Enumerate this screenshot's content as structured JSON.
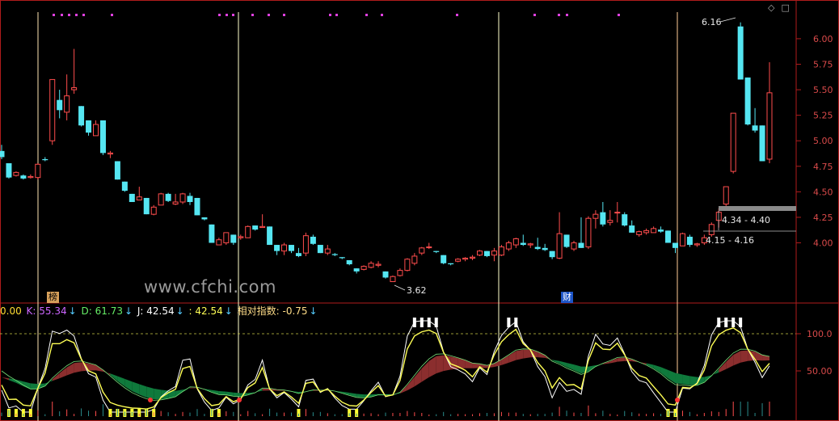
{
  "price_axis": {
    "ticks": [
      "6.00",
      "5.75",
      "5.50",
      "5.25",
      "5.00",
      "4.75",
      "4.50",
      "4.25",
      "4.00"
    ],
    "min": 3.45,
    "max": 6.3
  },
  "indicator_axis": {
    "ticks": [
      "100.0",
      "50.00"
    ]
  },
  "annotations": {
    "high_label": "6.16",
    "low_label": "3.62",
    "range_upper": "4.34 - 4.40",
    "range_lower": "4.15 - 4.16"
  },
  "tags": {
    "bang": "榜",
    "cai": "财"
  },
  "watermark": "www.cfchi.com",
  "indicator": {
    "prefix": "0.00",
    "k_label": "K: 55.34",
    "d_label": "D: 61.73",
    "j_label": "J: 42.54",
    "x_label": ": 42.54",
    "rel_label": "相对指数: -0.75",
    "arrow": "↓"
  },
  "icons": [
    "diamond-icon",
    "maximize-icon"
  ],
  "colors": {
    "up": "#ff4d4d",
    "down": "#55e6f2",
    "k_line": "#ffffff",
    "d_line": "#ffff55",
    "band_green": "#0f7a3c",
    "band_red": "#8b2e2e",
    "axis": "#b01c1c",
    "vline": "#ffffcc",
    "magenta": "#e040e0",
    "ref_line": "#cccc44"
  },
  "chart_data": {
    "type": "candlestick",
    "ohlc": [
      [
        4.9,
        4.96,
        4.82,
        4.84
      ],
      [
        4.78,
        4.78,
        4.63,
        4.64
      ],
      [
        4.66,
        4.7,
        4.65,
        4.69
      ],
      [
        4.66,
        4.67,
        4.62,
        4.63
      ],
      [
        4.64,
        4.67,
        4.63,
        4.65
      ],
      [
        4.64,
        4.78,
        4.62,
        4.77
      ],
      [
        4.82,
        4.84,
        4.8,
        4.81
      ],
      [
        5.0,
        5.6,
        4.96,
        5.6
      ],
      [
        5.4,
        5.5,
        5.22,
        5.3
      ],
      [
        5.28,
        5.65,
        5.2,
        5.44
      ],
      [
        5.5,
        5.9,
        5.46,
        5.52
      ],
      [
        5.34,
        5.34,
        5.14,
        5.15
      ],
      [
        5.2,
        5.2,
        5.05,
        5.08
      ],
      [
        5.05,
        5.2,
        5.05,
        5.16
      ],
      [
        5.2,
        5.2,
        4.86,
        4.88
      ],
      [
        4.87,
        4.9,
        4.83,
        4.88
      ],
      [
        4.8,
        4.8,
        4.62,
        4.62
      ],
      [
        4.6,
        4.6,
        4.5,
        4.51
      ],
      [
        4.48,
        4.48,
        4.4,
        4.4
      ],
      [
        4.42,
        4.55,
        4.42,
        4.45
      ],
      [
        4.44,
        4.44,
        4.28,
        4.28
      ],
      [
        4.28,
        4.37,
        4.27,
        4.35
      ],
      [
        4.37,
        4.49,
        4.37,
        4.48
      ],
      [
        4.48,
        4.49,
        4.4,
        4.41
      ],
      [
        4.38,
        4.48,
        4.37,
        4.4
      ],
      [
        4.4,
        4.49,
        4.38,
        4.48
      ],
      [
        4.46,
        4.49,
        4.37,
        4.4
      ],
      [
        4.44,
        4.44,
        4.27,
        4.27
      ],
      [
        4.25,
        4.25,
        4.22,
        4.23
      ],
      [
        4.18,
        4.18,
        4.0,
        4.0
      ],
      [
        3.98,
        4.05,
        3.98,
        4.03
      ],
      [
        4.0,
        4.1,
        3.98,
        4.1
      ],
      [
        4.08,
        4.08,
        3.98,
        4.0
      ],
      [
        4.05,
        4.08,
        4.03,
        4.06
      ],
      [
        4.05,
        4.17,
        4.05,
        4.16
      ],
      [
        4.17,
        4.17,
        4.12,
        4.13
      ],
      [
        4.15,
        4.28,
        4.15,
        4.16
      ],
      [
        4.16,
        4.16,
        3.98,
        3.98
      ],
      [
        3.98,
        3.98,
        3.88,
        3.92
      ],
      [
        3.92,
        4.0,
        3.88,
        3.98
      ],
      [
        3.98,
        3.98,
        3.9,
        3.92
      ],
      [
        3.9,
        3.95,
        3.86,
        3.87
      ],
      [
        3.9,
        4.1,
        3.87,
        4.07
      ],
      [
        4.06,
        4.08,
        3.98,
        3.99
      ],
      [
        3.98,
        3.98,
        3.9,
        3.9
      ],
      [
        3.9,
        3.98,
        3.88,
        3.94
      ],
      [
        3.89,
        3.9,
        3.87,
        3.88
      ],
      [
        3.86,
        3.86,
        3.84,
        3.85
      ],
      [
        3.83,
        3.83,
        3.78,
        3.79
      ],
      [
        3.75,
        3.75,
        3.7,
        3.72
      ],
      [
        3.74,
        3.78,
        3.73,
        3.77
      ],
      [
        3.76,
        3.82,
        3.75,
        3.8
      ],
      [
        3.78,
        3.82,
        3.76,
        3.79
      ],
      [
        3.72,
        3.72,
        3.65,
        3.66
      ],
      [
        3.62,
        3.68,
        3.62,
        3.67
      ],
      [
        3.68,
        3.75,
        3.67,
        3.73
      ],
      [
        3.73,
        3.85,
        3.72,
        3.84
      ],
      [
        3.8,
        3.9,
        3.78,
        3.87
      ],
      [
        3.9,
        3.96,
        3.88,
        3.95
      ],
      [
        3.96,
        4.0,
        3.94,
        3.96
      ],
      [
        3.92,
        3.92,
        3.9,
        3.91
      ],
      [
        3.88,
        3.88,
        3.79,
        3.8
      ],
      [
        3.8,
        3.8,
        3.78,
        3.79
      ],
      [
        3.82,
        3.85,
        3.81,
        3.84
      ],
      [
        3.84,
        3.86,
        3.82,
        3.85
      ],
      [
        3.85,
        3.88,
        3.83,
        3.86
      ],
      [
        3.88,
        3.93,
        3.87,
        3.92
      ],
      [
        3.92,
        3.92,
        3.86,
        3.87
      ],
      [
        3.88,
        3.95,
        3.82,
        3.92
      ],
      [
        3.88,
        3.98,
        3.87,
        3.96
      ],
      [
        3.94,
        4.02,
        3.92,
        4.0
      ],
      [
        3.98,
        4.05,
        3.95,
        4.04
      ],
      [
        4.0,
        4.08,
        3.97,
        3.98
      ],
      [
        3.98,
        4.0,
        3.95,
        3.99
      ],
      [
        3.96,
        4.05,
        3.93,
        3.94
      ],
      [
        3.95,
        3.99,
        3.92,
        3.93
      ],
      [
        3.92,
        3.92,
        3.84,
        3.86
      ],
      [
        3.85,
        4.3,
        3.84,
        4.09
      ],
      [
        4.08,
        4.08,
        3.95,
        3.96
      ],
      [
        3.94,
        4.02,
        3.92,
        4.0
      ],
      [
        4.0,
        4.25,
        3.95,
        3.95
      ],
      [
        3.96,
        4.26,
        3.94,
        4.24
      ],
      [
        4.24,
        4.32,
        4.14,
        4.28
      ],
      [
        4.3,
        4.4,
        4.16,
        4.18
      ],
      [
        4.2,
        4.32,
        4.17,
        4.22
      ],
      [
        4.3,
        4.4,
        4.2,
        4.3
      ],
      [
        4.28,
        4.3,
        4.16,
        4.17
      ],
      [
        4.17,
        4.22,
        4.1,
        4.1
      ],
      [
        4.08,
        4.12,
        4.06,
        4.11
      ],
      [
        4.1,
        4.14,
        4.08,
        4.12
      ],
      [
        4.1,
        4.16,
        4.1,
        4.14
      ],
      [
        4.13,
        4.16,
        4.1,
        4.11
      ],
      [
        4.12,
        4.12,
        4.0,
        4.0
      ],
      [
        4.0,
        4.0,
        3.9,
        3.95
      ],
      [
        3.97,
        4.1,
        3.97,
        4.09
      ],
      [
        4.06,
        4.08,
        3.96,
        3.98
      ],
      [
        3.98,
        4.0,
        3.96,
        3.99
      ],
      [
        4.0,
        4.08,
        3.98,
        4.05
      ],
      [
        4.08,
        4.2,
        4.06,
        4.18
      ],
      [
        4.22,
        4.34,
        4.15,
        4.3
      ],
      [
        4.38,
        4.55,
        4.36,
        4.55
      ],
      [
        4.7,
        5.27,
        4.68,
        5.27
      ],
      [
        6.12,
        6.16,
        5.6,
        5.6
      ],
      [
        5.62,
        5.62,
        5.15,
        5.16
      ],
      [
        5.15,
        5.32,
        5.08,
        5.1
      ],
      [
        5.15,
        5.15,
        4.8,
        4.8
      ],
      [
        4.82,
        5.77,
        4.78,
        5.47
      ]
    ]
  }
}
